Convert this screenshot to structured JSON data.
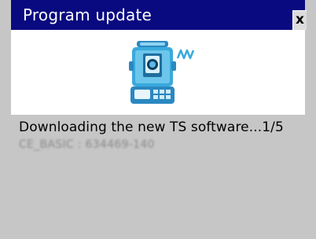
{
  "dialog": {
    "title": "Program update",
    "close_label": "x",
    "icon": "total-station-icon",
    "status_text": "Downloading the new TS software...1/5",
    "version_text": "CE_BASIC : 634469-140"
  },
  "colors": {
    "titlebar": "#0a0a80",
    "icon_area": "#ffffff",
    "content_bg": "#c6c6c6",
    "icon_body": "#3aa9dc"
  }
}
